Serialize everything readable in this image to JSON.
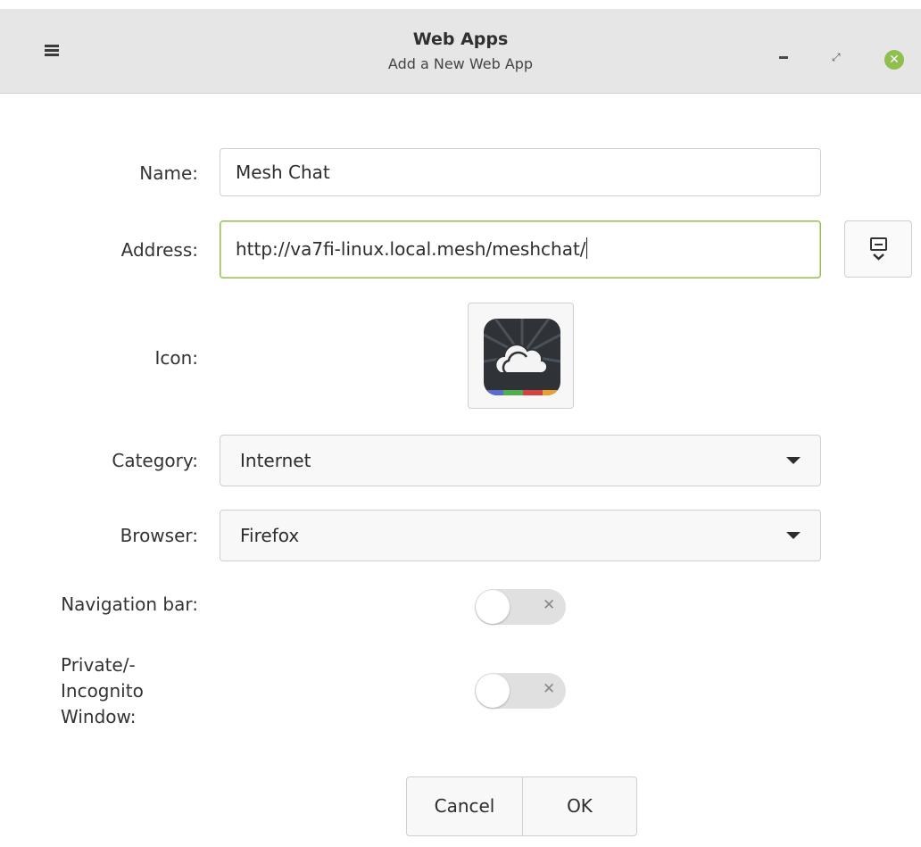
{
  "window": {
    "title": "Web Apps",
    "subtitle": "Add a New Web App",
    "accent": "#8fbf4f"
  },
  "form": {
    "name_label": "Name:",
    "name_value": "Mesh Chat",
    "address_label": "Address:",
    "address_value": "http://va7fi-linux.local.mesh/meshchat/",
    "icon_label": "Icon:",
    "category_label": "Category:",
    "category_value": "Internet",
    "browser_label": "Browser:",
    "browser_value": "Firefox",
    "navbar_label": "Navigation bar:",
    "navbar_enabled": false,
    "private_label_lines": [
      "Private/-",
      "Incognito",
      "Window:"
    ],
    "private_enabled": false
  },
  "buttons": {
    "cancel": "Cancel",
    "ok": "OK"
  },
  "icons": {
    "menu": "hamburger-icon",
    "minimize": "minimize-icon",
    "restore": "restore-icon",
    "close": "close-icon",
    "fetch_favicon": "download-favicon-icon",
    "app_icon": "cloud-icon"
  }
}
